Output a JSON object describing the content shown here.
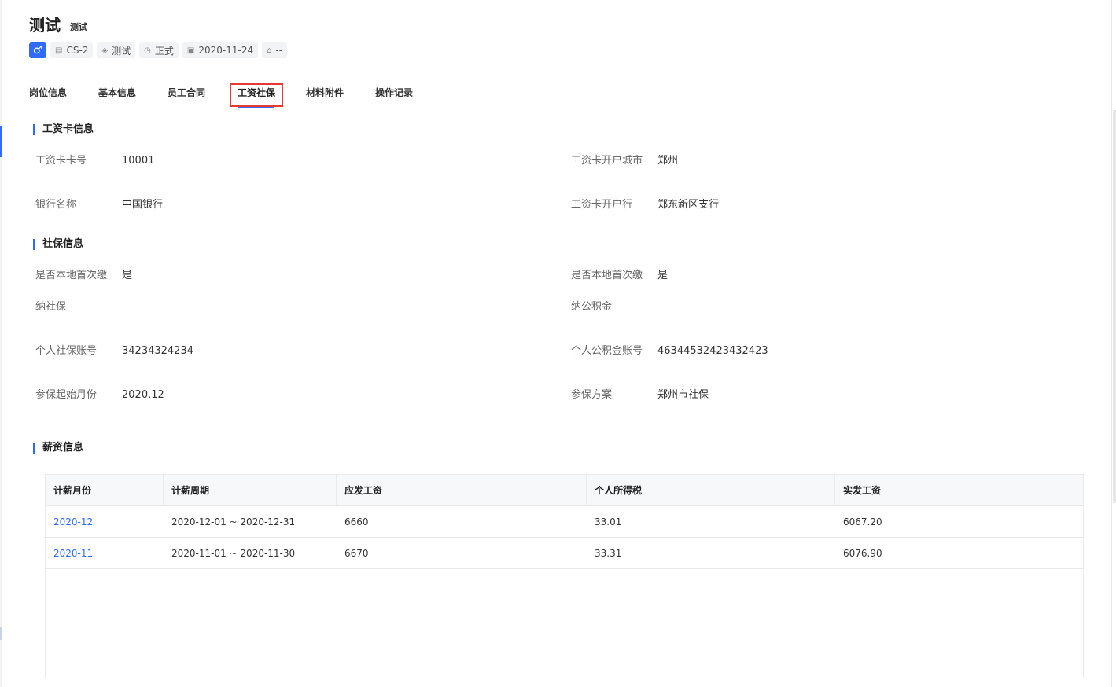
{
  "employee": {
    "name": "测试",
    "subname": "测试",
    "gender_icon": "♂",
    "tags": [
      {
        "icon": "clipboard-icon",
        "glyph": "▤",
        "text": "CS-2"
      },
      {
        "icon": "layers-icon",
        "glyph": "◈",
        "text": "测试"
      },
      {
        "icon": "clock-icon",
        "glyph": "◷",
        "text": "正式"
      },
      {
        "icon": "calendar-icon",
        "glyph": "▣",
        "text": "2020-11-24"
      },
      {
        "icon": "building-icon",
        "glyph": "⌂",
        "text": "--"
      }
    ]
  },
  "tabs": [
    "岗位信息",
    "基本信息",
    "员工合同",
    "工资社保",
    "材料附件",
    "操作记录"
  ],
  "active_tab": "工资社保",
  "salary_card": {
    "title": "工资卡信息",
    "card_no_label": "工资卡卡号",
    "card_no": "10001",
    "open_city_label": "工资卡开户城市",
    "open_city": "郑州",
    "bank_label": "银行名称",
    "bank": "中国银行",
    "branch_label": "工资卡开户行",
    "branch": "郑东新区支行"
  },
  "social": {
    "title": "社保信息",
    "first_local_label_1": "是否本地首次缴",
    "first_local_value_1": "是",
    "first_local_label_2": "是否本地首次缴",
    "first_local_value_2": "是",
    "social_label": "纳社保",
    "fund_label": "纳公积金",
    "social_account_label": "个人社保账号",
    "social_account": "34234324234",
    "fund_account_label": "个人公积金账号",
    "fund_account": "46344532423432423",
    "start_month_label": "参保起始月份",
    "start_month": "2020.12",
    "plan_label": "参保方案",
    "plan": "郑州市社保"
  },
  "pay": {
    "title": "薪资信息",
    "headers": [
      "计薪月份",
      "计薪周期",
      "应发工资",
      "个人所得税",
      "实发工资"
    ],
    "rows": [
      [
        "2020-12",
        "2020-12-01 ~ 2020-12-31",
        "6660",
        "33.01",
        "6067.20"
      ],
      [
        "2020-11",
        "2020-11-01 ~ 2020-11-30",
        "6670",
        "33.31",
        "6076.90"
      ]
    ]
  }
}
